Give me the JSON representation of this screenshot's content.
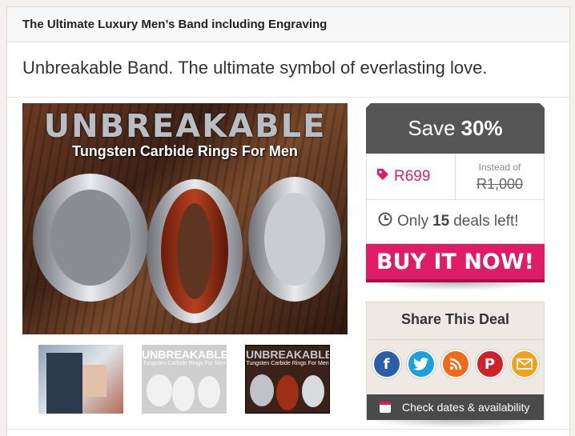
{
  "deal": {
    "title": "The Ultimate Luxury Men’s Band including Engraving",
    "subtitle": "Unbreakable Band. The ultimate symbol of everlasting love."
  },
  "hero": {
    "logo_text": "UNBREAKABLE",
    "tagline": "Tungsten Carbide Rings For Men"
  },
  "thumbnails": [
    {
      "label": "",
      "kind": "photo"
    },
    {
      "label": "UNBREAKABLE",
      "sub": "Tungsten Carbide Rings For Men",
      "kind": "rings-faded"
    },
    {
      "label": "UNBREAKABLE",
      "sub": "Tungsten Carbide Rings For Men",
      "kind": "rings-selected"
    }
  ],
  "pricing": {
    "save_label": "Save",
    "save_value": "30%",
    "price": "R699",
    "instead_label": "Instead of",
    "original_price": "R1,000",
    "deals_prefix": "Only",
    "deals_count": "15",
    "deals_suffix": "deals left!",
    "buy_label": "BUY IT NOW!"
  },
  "share": {
    "heading": "Share This Deal",
    "icons": [
      "facebook-icon",
      "twitter-icon",
      "rss-icon",
      "pinterest-icon",
      "email-icon"
    ],
    "dates_label": "Check dates & availability"
  },
  "colors": {
    "accent": "#e01c66",
    "dark": "#555555",
    "facebook": "#2a5fa8",
    "twitter": "#1aa0dd",
    "rss": "#f06a1a",
    "pinterest": "#d0202a",
    "email": "#f2a21a"
  }
}
